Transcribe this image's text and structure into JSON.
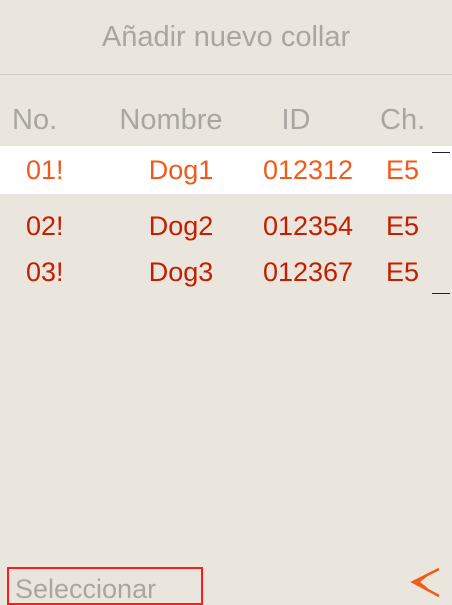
{
  "screen": {
    "title": "Añadir nuevo collar",
    "select_label": "Seleccionar",
    "accent_color": "#f15a1a",
    "row_color": "#c41e00",
    "muted_color": "#a9a6a2",
    "highlight_border": "#ff1b1b"
  },
  "table": {
    "headers": {
      "no": "No.",
      "name": "Nombre",
      "id": "ID",
      "ch": "Ch."
    },
    "rows": [
      {
        "no": "01!",
        "name": "Dog1",
        "id": "012312",
        "ch": "E5",
        "selected": true
      },
      {
        "no": "02!",
        "name": "Dog2",
        "id": "012354",
        "ch": "E5",
        "selected": false
      },
      {
        "no": "03!",
        "name": "Dog3",
        "id": "012367",
        "ch": "E5",
        "selected": false
      }
    ]
  },
  "icons": {
    "back": "back-double-chevron-icon"
  }
}
